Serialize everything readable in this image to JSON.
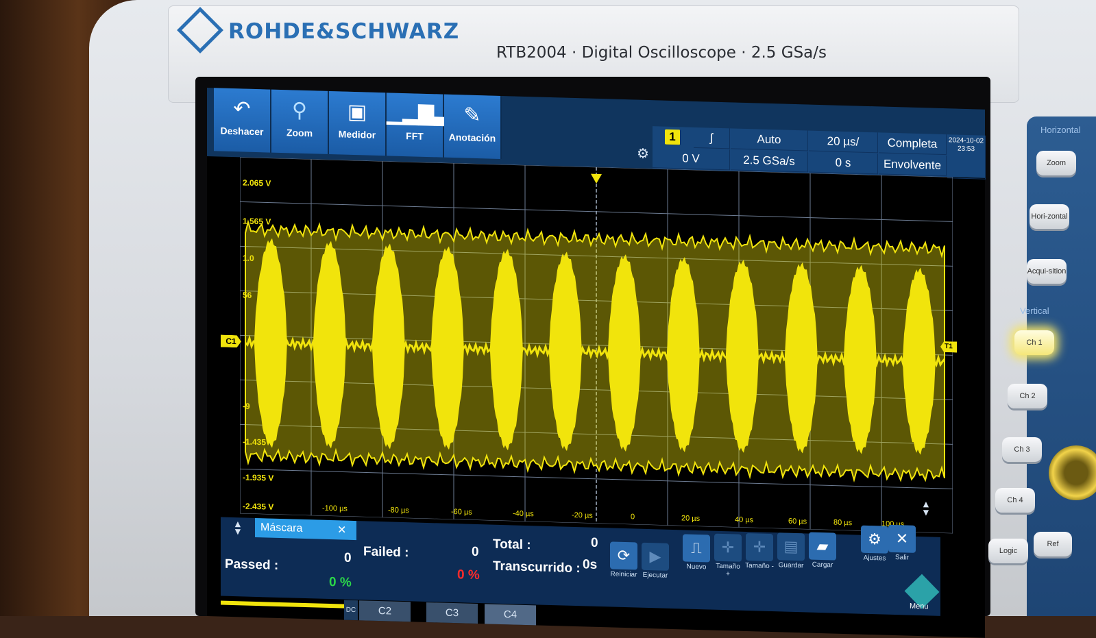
{
  "brand": {
    "logo": "ROHDE&SCHWARZ",
    "model": "RTB2004 · Digital Oscilloscope · 2.5 GSa/s"
  },
  "toolbar": [
    {
      "label": "Deshacer",
      "icon": "undo-icon"
    },
    {
      "label": "Zoom",
      "icon": "zoom-icon"
    },
    {
      "label": "Medidor",
      "icon": "meter-icon"
    },
    {
      "label": "FFT",
      "icon": "fft-icon"
    },
    {
      "label": "Anotación",
      "icon": "pencil-icon"
    }
  ],
  "info": {
    "trigger_channel": "1",
    "slope": "ʃ",
    "trigger_level": "0 V",
    "mode": "Auto",
    "sample_rate": "2.5 GSa/s",
    "time_scale": "20 µs/",
    "time_offset": "0 s",
    "acq_mode": "Completa",
    "display_mode": "Envolvente",
    "date": "2024-10-02",
    "time": "23:53"
  },
  "y_labels": [
    "2.065 V",
    "1.565 V",
    "1.0",
    "56",
    "-9",
    "-1.435 V",
    "-1.935 V",
    "-2.435 V"
  ],
  "x_labels": [
    "-100 µs",
    "-80 µs",
    "-60 µs",
    "-40 µs",
    "-20 µs",
    "0",
    "20 µs",
    "40 µs",
    "60 µs",
    "80 µs",
    "100 µs"
  ],
  "markers": {
    "channel": "C1",
    "trigger": "T1"
  },
  "mask": {
    "tab": "Máscara",
    "passed_label": "Passed :",
    "passed": "0",
    "passed_pct": "0 %",
    "failed_label": "Failed :",
    "failed": "0",
    "failed_pct": "0 %",
    "total_label": "Total :",
    "total": "0",
    "elapsed_label": "Transcurrido :",
    "elapsed": "0s",
    "actions": [
      {
        "label": "Reiniciar",
        "icon": "reset-icon"
      },
      {
        "label": "Ejecutar",
        "icon": "play-icon"
      },
      {
        "label": "Nuevo",
        "icon": "new-mask-icon"
      },
      {
        "label": "Tamaño +",
        "icon": "size-up-icon"
      },
      {
        "label": "Tamaño -",
        "icon": "size-down-icon"
      },
      {
        "label": "Guardar",
        "icon": "save-icon"
      },
      {
        "label": "Cargar",
        "icon": "folder-icon"
      },
      {
        "label": "Ajustes",
        "icon": "gear-icon"
      },
      {
        "label": "Salir",
        "icon": "close-icon"
      }
    ],
    "menu": "Menu"
  },
  "bottom_tabs": [
    "DC",
    "C2",
    "C3",
    "C4"
  ],
  "side_panel": {
    "horizontal_label": "Horizontal",
    "vertical_label": "Vertical",
    "buttons": [
      "Zoom",
      "Hori-zontal",
      "Acqui-sition",
      "Ch 1",
      "Ch 2",
      "Ch 3",
      "Ch 4",
      "Logic",
      "Ref"
    ]
  },
  "colors": {
    "trace": "#f1e40c",
    "toolbar": "#2c7bd0",
    "panel": "#0d2c55",
    "accent": "#2c9ce6"
  }
}
